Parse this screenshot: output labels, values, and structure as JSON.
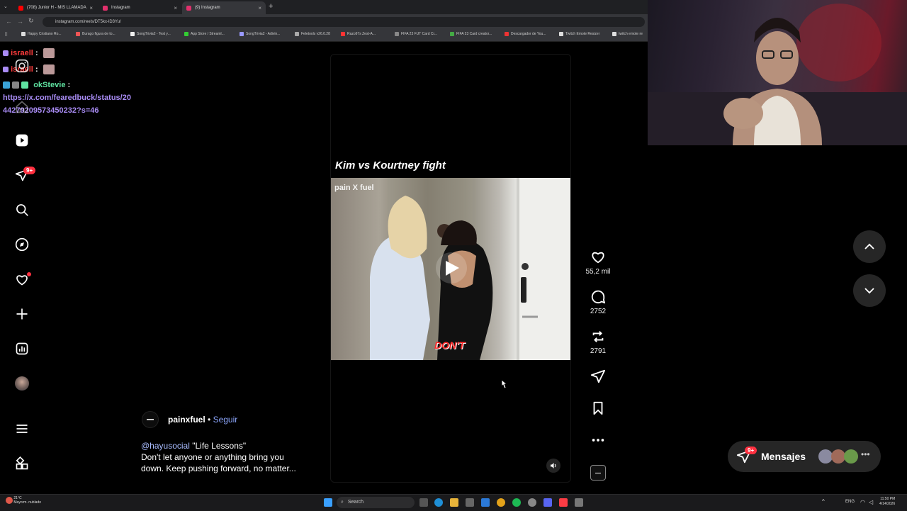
{
  "browser": {
    "tabs": [
      {
        "label": "(708) Junior H - MIS LLAMADA",
        "icon": "youtube-icon",
        "color": "#ff0000"
      },
      {
        "label": "Instagram",
        "icon": "instagram-icon",
        "color": "#e1306c"
      },
      {
        "label": "(9) Instagram",
        "icon": "instagram-icon",
        "color": "#e1306c"
      }
    ],
    "url": "instagram.com/reels/DT5kx-lD3Yu/",
    "bookmarks": [
      "Happy Cristiano Ro...",
      "Burago figura de to...",
      "SongTrivia2 - Test y...",
      "App Store / Streaml...",
      "SongTrivia2 - Adivin...",
      "Feletools v26.0.28",
      "Razo97s Zest-A...",
      "FIFA 23 FUT Card Cr...",
      "FIFA 23 Card creator...",
      "Descargador de You...",
      "Twitch Emote Resizer",
      "twitch emote re"
    ]
  },
  "chat": {
    "line1_user": "israell",
    "line2_user": "israell",
    "line3_user": "okStevie",
    "separator": ":",
    "link": "https://x.com/fearedbuck/status/2044279209573450232?s=46",
    "link_line1": "https://x.com/fearedbuck/status/20",
    "link_line2": "44279209573450232?s=46"
  },
  "sidebar": {
    "notif_badge": "9+"
  },
  "reel": {
    "title": "Kim vs Kourtney fight",
    "watermark": "pain X fuel",
    "caption_word": "DON'T",
    "likes": "55,2 mil",
    "comments": "2752",
    "reposts": "2791"
  },
  "author": {
    "name": "painxfuel",
    "dot": "•",
    "follow": "Seguir",
    "mention": "@hayusocial",
    "desc_line1_rest": " \"Life Lessons\"",
    "desc_line2": "Don't let anyone or anything bring you",
    "desc_line3": "down. Keep pushing forward, no matter..."
  },
  "messages": {
    "label": "Mensajes",
    "badge": "9+"
  },
  "taskbar": {
    "weather_temp": "21°C",
    "weather_desc": "Mayorm. nublado",
    "search": "Search",
    "lang": "ENG",
    "time": "11:50 PM",
    "date": "4/14/2026"
  },
  "colors": {
    "accent": "#0095f6",
    "chat_link": "#a98cf5",
    "chat_user_red": "#ff3b3b",
    "chat_user_green": "#5fe3a1",
    "badge": "#ff3040"
  }
}
